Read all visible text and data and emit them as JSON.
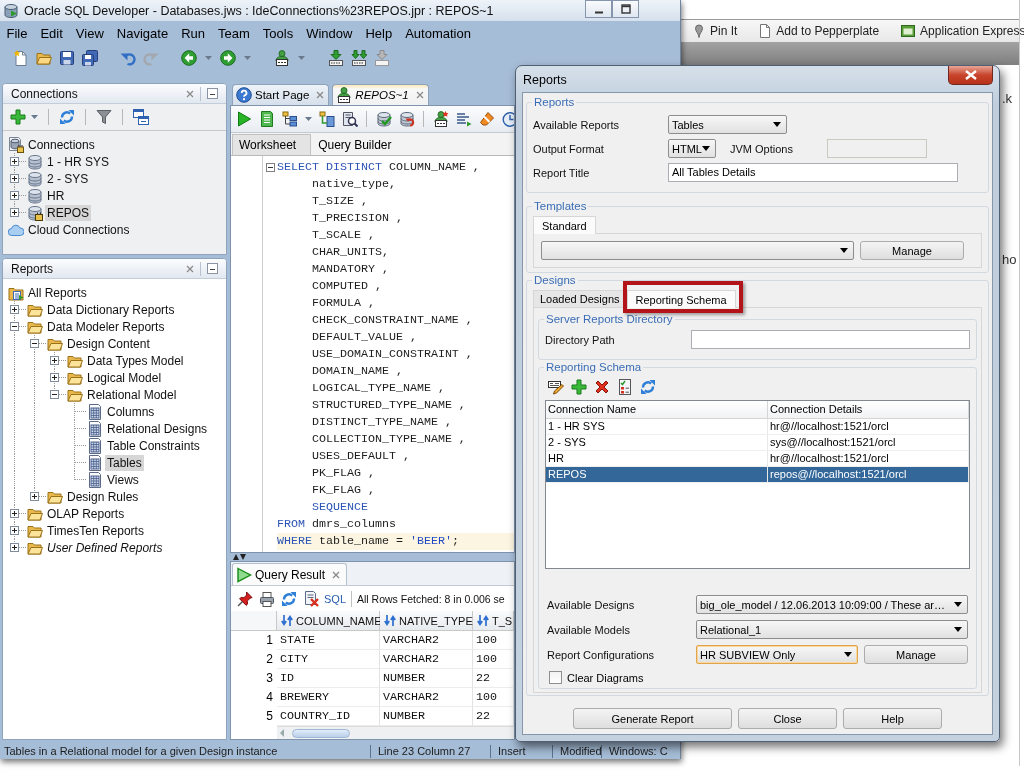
{
  "background_window": {
    "bookmarks": [
      "Pin It",
      "Add to Pepperplate",
      "Application Express"
    ],
    "page_fragments": [
      ".k",
      "ho"
    ]
  },
  "window": {
    "title": "Oracle SQL Developer - Databases.jws : IdeConnections%23REPOS.jpr : REPOS~1"
  },
  "menu": [
    "File",
    "Edit",
    "View",
    "Navigate",
    "Run",
    "Team",
    "Tools",
    "Window",
    "Help",
    "Automation"
  ],
  "connections_panel": {
    "title": "Connections",
    "tree": [
      {
        "label": "Connections",
        "kind": "root",
        "selected": false,
        "children": [
          {
            "label": "1 - HR SYS",
            "kind": "database",
            "expanded": false,
            "selected": false
          },
          {
            "label": "2 - SYS",
            "kind": "database",
            "expanded": false,
            "selected": false
          },
          {
            "label": "HR",
            "kind": "database",
            "expanded": false,
            "selected": false
          },
          {
            "label": "REPOS",
            "kind": "database-connected",
            "expanded": false,
            "selected": true
          }
        ]
      },
      {
        "label": "Cloud Connections",
        "kind": "cloud",
        "selected": false
      }
    ]
  },
  "reports_panel": {
    "title": "Reports",
    "tree": [
      {
        "label": "All Reports",
        "kind": "root",
        "selected": false,
        "children": [
          {
            "label": "Data Dictionary Reports",
            "kind": "folder",
            "expanded": false,
            "selected": false
          },
          {
            "label": "Data Modeler Reports",
            "kind": "folder",
            "expanded": true,
            "selected": false,
            "children": [
              {
                "label": "Design Content",
                "kind": "folder",
                "expanded": true,
                "selected": false,
                "children": [
                  {
                    "label": "Data Types Model",
                    "kind": "folder",
                    "expanded": false,
                    "selected": false
                  },
                  {
                    "label": "Logical Model",
                    "kind": "folder",
                    "expanded": false,
                    "selected": false
                  },
                  {
                    "label": "Relational Model",
                    "kind": "folder",
                    "expanded": true,
                    "selected": false,
                    "children": [
                      {
                        "label": "Columns",
                        "kind": "report",
                        "selected": false
                      },
                      {
                        "label": "Relational Designs",
                        "kind": "report",
                        "selected": false
                      },
                      {
                        "label": "Table Constraints",
                        "kind": "report",
                        "selected": false
                      },
                      {
                        "label": "Tables",
                        "kind": "report",
                        "selected": true
                      },
                      {
                        "label": "Views",
                        "kind": "report",
                        "selected": false
                      }
                    ]
                  }
                ]
              },
              {
                "label": "Design Rules",
                "kind": "folder",
                "expanded": false,
                "selected": false
              }
            ]
          },
          {
            "label": "OLAP Reports",
            "kind": "folder",
            "expanded": false,
            "selected": false
          },
          {
            "label": "TimesTen Reports",
            "kind": "folder",
            "expanded": false,
            "selected": false
          },
          {
            "label": "User Defined Reports",
            "kind": "user-folder",
            "expanded": false,
            "selected": false
          }
        ]
      }
    ]
  },
  "editor": {
    "tabs": [
      {
        "label": "Start Page",
        "kind": "help",
        "selected": false
      },
      {
        "label": "REPOS~1",
        "kind": "sql",
        "selected": true
      }
    ],
    "sub_tabs": [
      {
        "label": "Worksheet",
        "selected": true
      },
      {
        "label": "Query Builder",
        "selected": false
      }
    ],
    "code_lines": [
      {
        "tokens": [
          {
            "text": "SELECT DISTINCT",
            "kind": "keyword"
          },
          {
            "text": " COLUMN_NAME ,",
            "kind": "plain"
          }
        ],
        "fold": true,
        "current": false
      },
      {
        "tokens": [
          {
            "text": "     native_type,",
            "kind": "plain"
          }
        ],
        "fold": false,
        "current": false
      },
      {
        "tokens": [
          {
            "text": "     T_SIZE ,",
            "kind": "plain"
          }
        ],
        "fold": false,
        "current": false
      },
      {
        "tokens": [
          {
            "text": "     T_PRECISION ,",
            "kind": "plain"
          }
        ],
        "fold": false,
        "current": false
      },
      {
        "tokens": [
          {
            "text": "     T_SCALE ,",
            "kind": "plain"
          }
        ],
        "fold": false,
        "current": false
      },
      {
        "tokens": [
          {
            "text": "     CHAR_UNITS,",
            "kind": "plain"
          }
        ],
        "fold": false,
        "current": false
      },
      {
        "tokens": [
          {
            "text": "     MANDATORY ,",
            "kind": "plain"
          }
        ],
        "fold": false,
        "current": false
      },
      {
        "tokens": [
          {
            "text": "     COMPUTED ,",
            "kind": "plain"
          }
        ],
        "fold": false,
        "current": false
      },
      {
        "tokens": [
          {
            "text": "     FORMULA ,",
            "kind": "plain"
          }
        ],
        "fold": false,
        "current": false
      },
      {
        "tokens": [
          {
            "text": "     CHECK_CONSTRAINT_NAME ,",
            "kind": "plain"
          }
        ],
        "fold": false,
        "current": false
      },
      {
        "tokens": [
          {
            "text": "     DEFAULT_VALUE ,",
            "kind": "plain"
          }
        ],
        "fold": false,
        "current": false
      },
      {
        "tokens": [
          {
            "text": "     USE_DOMAIN_CONSTRAINT ,",
            "kind": "plain"
          }
        ],
        "fold": false,
        "current": false
      },
      {
        "tokens": [
          {
            "text": "     DOMAIN_NAME ,",
            "kind": "plain"
          }
        ],
        "fold": false,
        "current": false
      },
      {
        "tokens": [
          {
            "text": "     LOGICAL_TYPE_NAME ,",
            "kind": "plain"
          }
        ],
        "fold": false,
        "current": false
      },
      {
        "tokens": [
          {
            "text": "     STRUCTURED_TYPE_NAME ,",
            "kind": "plain"
          }
        ],
        "fold": false,
        "current": false
      },
      {
        "tokens": [
          {
            "text": "     DISTINCT_TYPE_NAME ,",
            "kind": "plain"
          }
        ],
        "fold": false,
        "current": false
      },
      {
        "tokens": [
          {
            "text": "     COLLECTION_TYPE_NAME ,",
            "kind": "plain"
          }
        ],
        "fold": false,
        "current": false
      },
      {
        "tokens": [
          {
            "text": "     USES_DEFAULT ,",
            "kind": "plain"
          }
        ],
        "fold": false,
        "current": false
      },
      {
        "tokens": [
          {
            "text": "     PK_FLAG ,",
            "kind": "plain"
          }
        ],
        "fold": false,
        "current": false
      },
      {
        "tokens": [
          {
            "text": "     FK_FLAG ,",
            "kind": "plain"
          }
        ],
        "fold": false,
        "current": false
      },
      {
        "tokens": [
          {
            "text": "     SEQUENCE",
            "kind": "keyword"
          }
        ],
        "fold": false,
        "current": false
      },
      {
        "tokens": [
          {
            "text": "FROM",
            "kind": "keyword"
          },
          {
            "text": " dmrs_columns",
            "kind": "plain"
          }
        ],
        "fold": false,
        "current": false
      },
      {
        "tokens": [
          {
            "text": "WHERE",
            "kind": "keyword"
          },
          {
            "text": " table_name = ",
            "kind": "plain"
          },
          {
            "text": "'BEER'",
            "kind": "string"
          },
          {
            "text": ";",
            "kind": "plain"
          }
        ],
        "fold": false,
        "current": true
      }
    ]
  },
  "query_result": {
    "tab": "Query Result",
    "sql_link": "SQL",
    "message": "All Rows Fetched: 8 in 0.006 se",
    "columns": [
      "COLUMN_NAME",
      "NATIVE_TYPE",
      "T_S"
    ],
    "rows": [
      {
        "number": "1",
        "cells": [
          "STATE",
          "VARCHAR2",
          "100"
        ]
      },
      {
        "number": "2",
        "cells": [
          "CITY",
          "VARCHAR2",
          "100"
        ]
      },
      {
        "number": "3",
        "cells": [
          "ID",
          "NUMBER",
          "22"
        ]
      },
      {
        "number": "4",
        "cells": [
          "BREWERY",
          "VARCHAR2",
          "100"
        ]
      },
      {
        "number": "5",
        "cells": [
          "COUNTRY_ID",
          "NUMBER",
          "22"
        ]
      }
    ]
  },
  "status_bar": {
    "message": "Tables in a Relational model for a given Design instance",
    "fields": [
      "Line 23 Column 27",
      "Insert",
      "Modified",
      "Windows: C"
    ]
  },
  "dialog": {
    "title": "Reports",
    "reports_group": {
      "title": "Reports",
      "available_reports": {
        "label": "Available Reports",
        "value": "Tables"
      },
      "output_format": {
        "label": "Output Format",
        "value": "HTML"
      },
      "jvm_options": {
        "label": "JVM Options",
        "disabled": true
      },
      "report_title": {
        "label": "Report Title",
        "value": "All Tables Details"
      }
    },
    "templates_group": {
      "title": "Templates",
      "tabs": [
        {
          "label": "Standard",
          "selected": true
        }
      ],
      "manage_button": "Manage"
    },
    "designs_group": {
      "title": "Designs",
      "tabs": [
        {
          "label": "Loaded Designs",
          "selected": false,
          "highlighted": false
        },
        {
          "label": "Reporting Schema",
          "selected": true,
          "highlighted": true
        }
      ],
      "server_reports_directory": {
        "title": "Server Reports Directory",
        "directory_path": {
          "label": "Directory Path",
          "disabled": false
        }
      },
      "reporting_schema": {
        "title": "Reporting Schema",
        "columns": [
          "Connection Name",
          "Connection Details"
        ],
        "rows": [
          {
            "cells": [
              "1 - HR SYS",
              "hr@//localhost:1521/orcl"
            ],
            "selected": false
          },
          {
            "cells": [
              "2 - SYS",
              "sys@//localhost:1521/orcl"
            ],
            "selected": false
          },
          {
            "cells": [
              "HR",
              "hr@//localhost:1521/orcl"
            ],
            "selected": false
          },
          {
            "cells": [
              "REPOS",
              "repos@//localhost:1521/orcl"
            ],
            "selected": true
          }
        ],
        "available_designs": {
          "label": "Available Designs",
          "value": "big_ole_model / 12.06.2013 10:09:00 / These ar…"
        },
        "available_models": {
          "label": "Available Models",
          "value": "Relational_1"
        },
        "report_configurations": {
          "label": "Report Configurations",
          "value": "HR SUBVIEW Only",
          "focused": true,
          "manage_button": "Manage"
        },
        "clear_diagrams": {
          "label": "Clear Diagrams",
          "checked": false
        }
      }
    },
    "buttons": [
      "Generate Report",
      "Close",
      "Help"
    ]
  }
}
